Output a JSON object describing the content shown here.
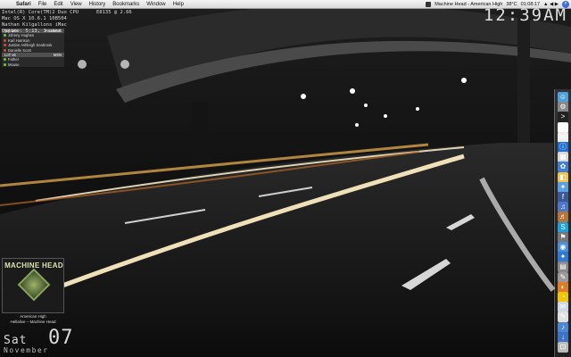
{
  "menubar": {
    "apple": "",
    "app_name": "Safari",
    "menus": [
      "File",
      "Edit",
      "View",
      "History",
      "Bookmarks",
      "Window",
      "Help"
    ],
    "now_playing": "Machine Head - American High",
    "temperature": "38°C",
    "battery_time": "01:08:17",
    "right_glyphs": "▲ ◀ ▶",
    "spotlight": "⌕"
  },
  "clock": {
    "time": "12:39AM"
  },
  "sysinfo": {
    "line1": "Intel(R) Core(TM)2 Duo CPU      E8135 @ 2.66",
    "line2": "Mac OS X 10.6.1 10B504",
    "line3": "Nathan Kilgallons iMac",
    "line4": "Uptime: 5:13, 1 user"
  },
  "contacts": {
    "group1": {
      "name": "Top Mo",
      "label": "Facebook"
    },
    "group1_items": [
      {
        "name": "Johnny Hughes",
        "color": "#6ccf2f"
      },
      {
        "name": "Karl Harrison",
        "color": "#d94a3a"
      },
      {
        "name": "Justine Ashleigh Seabrook",
        "color": "#d94a3a"
      },
      {
        "name": "Danielle Scott",
        "color": "#d94a3a"
      }
    ],
    "group2": {
      "name": "LoT v6",
      "label": "MSN"
    },
    "group2_items": [
      {
        "name": "Father",
        "color": "#6ccf2f"
      },
      {
        "name": "Mouse",
        "color": "#6ccf2f"
      }
    ]
  },
  "now_playing": {
    "album_title": "MACHINE HEAD",
    "album_sub": "HELLALIVE",
    "track": "American High",
    "album_artist": "Hellalive – Machine Head"
  },
  "date": {
    "day": "Sat",
    "day_number": "07",
    "month": "November"
  },
  "dock": {
    "icons": [
      {
        "name": "finder-icon",
        "glyph": "☺",
        "color": "#4aa3df"
      },
      {
        "name": "system-prefs-icon",
        "glyph": "⚙",
        "color": "#888888"
      },
      {
        "name": "terminal-icon",
        "glyph": ">",
        "color": "#222222"
      },
      {
        "name": "adium-icon",
        "glyph": "✈",
        "color": "#ffffff"
      },
      {
        "name": "chat-bubble-icon",
        "glyph": "✉",
        "color": "#eeeeee"
      },
      {
        "name": "info-icon",
        "glyph": "ⓘ",
        "color": "#1d6fd4"
      },
      {
        "name": "calendar-icon",
        "glyph": "▦",
        "color": "#d8d8d8"
      },
      {
        "name": "iphoto-icon",
        "glyph": "✿",
        "color": "#3d7fd9"
      },
      {
        "name": "preview-icon",
        "glyph": "◧",
        "color": "#f2c24d"
      },
      {
        "name": "safari-compass-icon",
        "glyph": "✦",
        "color": "#5aa0e8"
      },
      {
        "name": "facebook-icon",
        "glyph": "f",
        "color": "#3b5998"
      },
      {
        "name": "itunes-icon",
        "glyph": "♫",
        "color": "#4a77c9"
      },
      {
        "name": "guitar-icon",
        "glyph": "♬",
        "color": "#b5763a"
      },
      {
        "name": "skype-icon",
        "glyph": "S",
        "color": "#1e9fe0"
      },
      {
        "name": "utility-icon",
        "glyph": "⚑",
        "color": "#777777"
      },
      {
        "name": "globe-icon",
        "glyph": "◉",
        "color": "#4a90d9"
      },
      {
        "name": "network-icon",
        "glyph": "✦",
        "color": "#2d7ad4"
      },
      {
        "name": "apps-icon",
        "glyph": "▤",
        "color": "#8a8a8a"
      },
      {
        "name": "tools-icon",
        "glyph": "✎",
        "color": "#999999"
      },
      {
        "name": "firefox-icon",
        "glyph": "◐",
        "color": "#e37b22"
      },
      {
        "name": "pacman-icon",
        "glyph": "◔",
        "color": "#f2c500"
      },
      {
        "name": "mail-icon",
        "glyph": "✉",
        "color": "#cfd8e5"
      },
      {
        "name": "textedit-icon",
        "glyph": "✎",
        "color": "#e0e0e0"
      },
      {
        "name": "audio-icon",
        "glyph": "♪",
        "color": "#4a88d6"
      },
      {
        "name": "downloads-icon",
        "glyph": "↓",
        "color": "#3b73c9"
      },
      {
        "name": "trash-icon",
        "glyph": "⊡",
        "color": "#bbbbbb"
      }
    ]
  }
}
